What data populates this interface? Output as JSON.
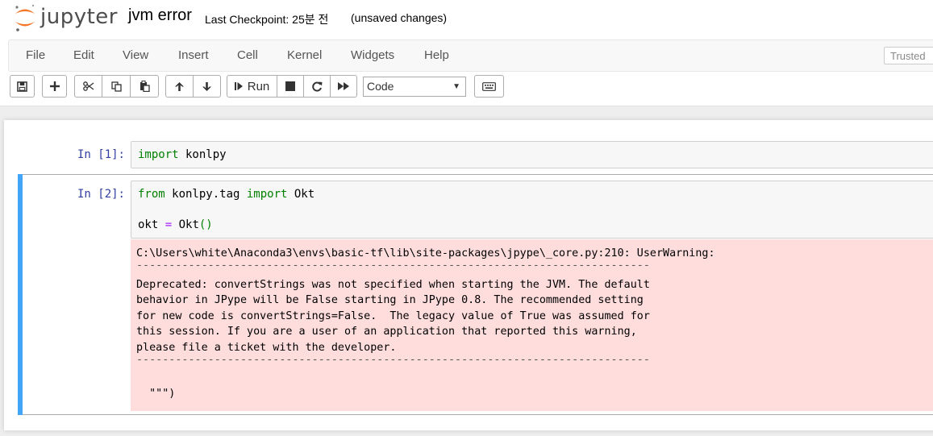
{
  "header": {
    "logo_text": "jupyter",
    "notebook_name": "jvm error",
    "checkpoint": "Last Checkpoint: 25분 전",
    "autosave_status": "(unsaved changes)"
  },
  "menu": {
    "items": [
      "File",
      "Edit",
      "View",
      "Insert",
      "Cell",
      "Kernel",
      "Widgets",
      "Help"
    ],
    "trusted_label": "Trusted"
  },
  "toolbar": {
    "run_label": "Run",
    "cell_type": "Code",
    "icons": [
      "save-icon",
      "plus-icon",
      "cut-icon",
      "copy-icon",
      "paste-icon",
      "arrow-up-icon",
      "arrow-down-icon",
      "step-forward-icon",
      "stop-icon",
      "restart-icon",
      "fast-forward-icon",
      "keyboard-icon"
    ]
  },
  "cells": [
    {
      "prompt": "In [1]:",
      "code": [
        {
          "kw": "import",
          "rest": " konlpy"
        }
      ]
    },
    {
      "prompt": "In [2]:",
      "code": [
        {
          "kw1": "from",
          "mid": " konlpy.tag ",
          "kw2": "import",
          "rest": " Okt"
        },
        {
          "lhs": "okt ",
          "op": "=",
          "rhs": " Okt",
          "paren": "()"
        }
      ],
      "stderr": [
        "C:\\Users\\white\\Anaconda3\\envs\\basic-tf\\lib\\site-packages\\jpype\\_core.py:210: UserWarning:",
        "-------------------------------------------------------------------------------",
        "Deprecated: convertStrings was not specified when starting the JVM. The default",
        "behavior in JPype will be False starting in JPype 0.8. The recommended setting",
        "for new code is convertStrings=False.  The legacy value of True was assumed for",
        "this session. If you are a user of an application that reported this warning,",
        "please file a ticket with the developer.",
        "-------------------------------------------------------------------------------",
        "",
        "  \"\"\")"
      ]
    }
  ],
  "colors": {
    "prompt": "#303f9f",
    "keyword": "#008000",
    "operator": "#aa22ff",
    "stderr_bg": "#ffdddd",
    "selected_bar": "#42a5f5"
  }
}
